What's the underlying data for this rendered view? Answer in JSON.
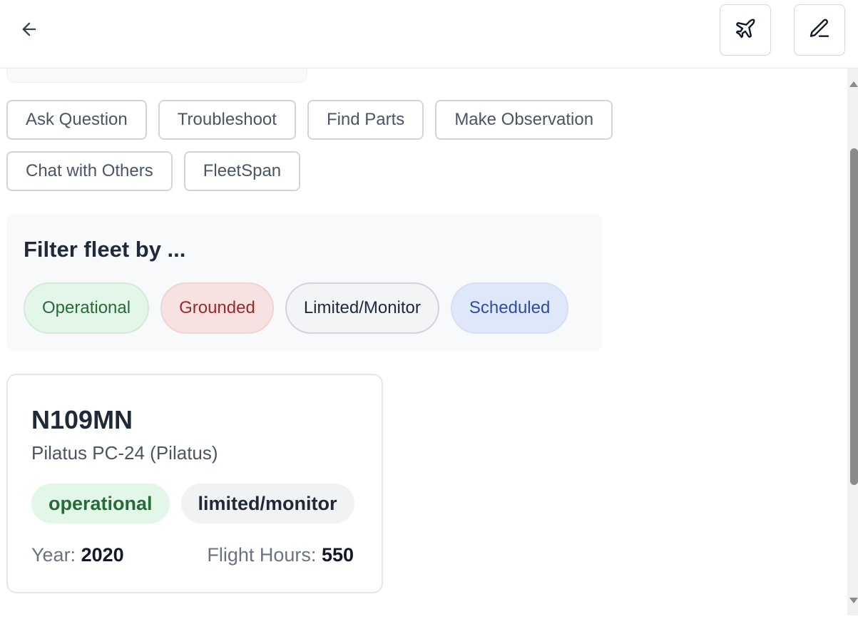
{
  "header": {
    "back_icon": "arrow-left-icon",
    "plane_icon": "plane-icon",
    "edit_icon": "pencil-icon"
  },
  "actions": [
    "Ask Question",
    "Troubleshoot",
    "Find Parts",
    "Make Observation",
    "Chat with Others",
    "FleetSpan"
  ],
  "filter": {
    "title": "Filter fleet by ...",
    "chips": [
      "Operational",
      "Grounded",
      "Limited/Monitor",
      "Scheduled"
    ],
    "chip_colors": {
      "operational": "#e3f7e9",
      "grounded": "#f8e1e1",
      "limited": "#f3f4f6",
      "scheduled": "#dfe8fb"
    }
  },
  "aircraft": {
    "tail": "N109MN",
    "model": "Pilatus PC-24 (Pilatus)",
    "statuses": [
      "operational",
      "limited/monitor"
    ],
    "year_label": "Year:",
    "year": "2020",
    "hours_label": "Flight Hours:",
    "hours": "550"
  }
}
